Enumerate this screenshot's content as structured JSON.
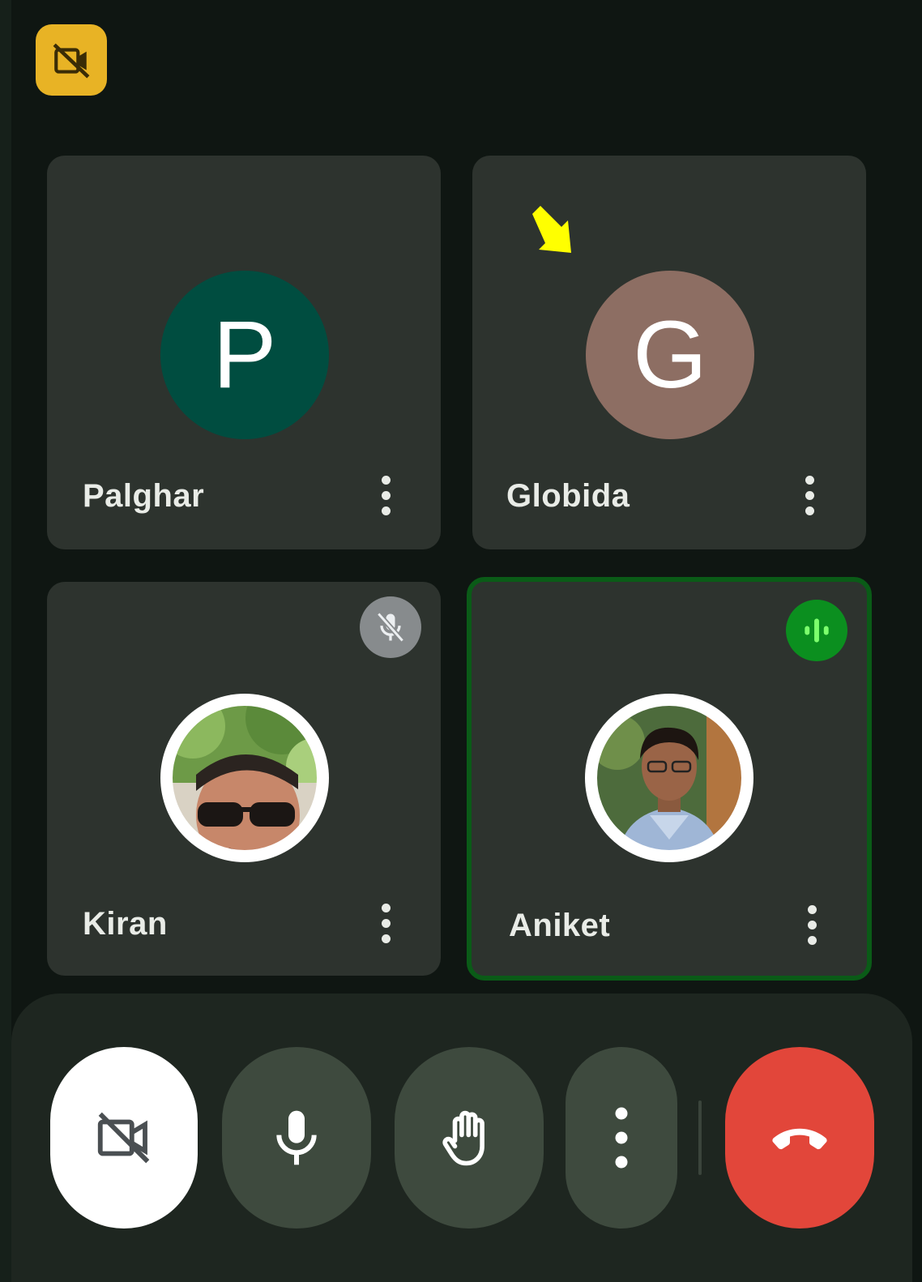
{
  "participants": [
    {
      "name": "Palghar",
      "initial": "P",
      "avatar_color": "#004d40"
    },
    {
      "name": "Globida",
      "initial": "G",
      "avatar_color": "#8d6e63"
    },
    {
      "name": "Kiran",
      "status": "muted"
    },
    {
      "name": "Aniket",
      "status": "speaking"
    }
  ],
  "colors": {
    "background": "#0f1612",
    "tile": "#2d332e",
    "speaking_border": "#0a5b17",
    "speaking_indicator": "#0b8f1f",
    "badge": "#e8b325",
    "end_call": "#e2463a",
    "annotation_arrow": "#ffff00"
  },
  "icons": {
    "top_badge": "camera-off-icon",
    "kiran_status": "mic-off-icon",
    "aniket_status": "audio-wave-icon",
    "controls": [
      "camera-off-icon",
      "microphone-icon",
      "hand-raise-icon",
      "more-options-icon",
      "end-call-icon"
    ]
  }
}
